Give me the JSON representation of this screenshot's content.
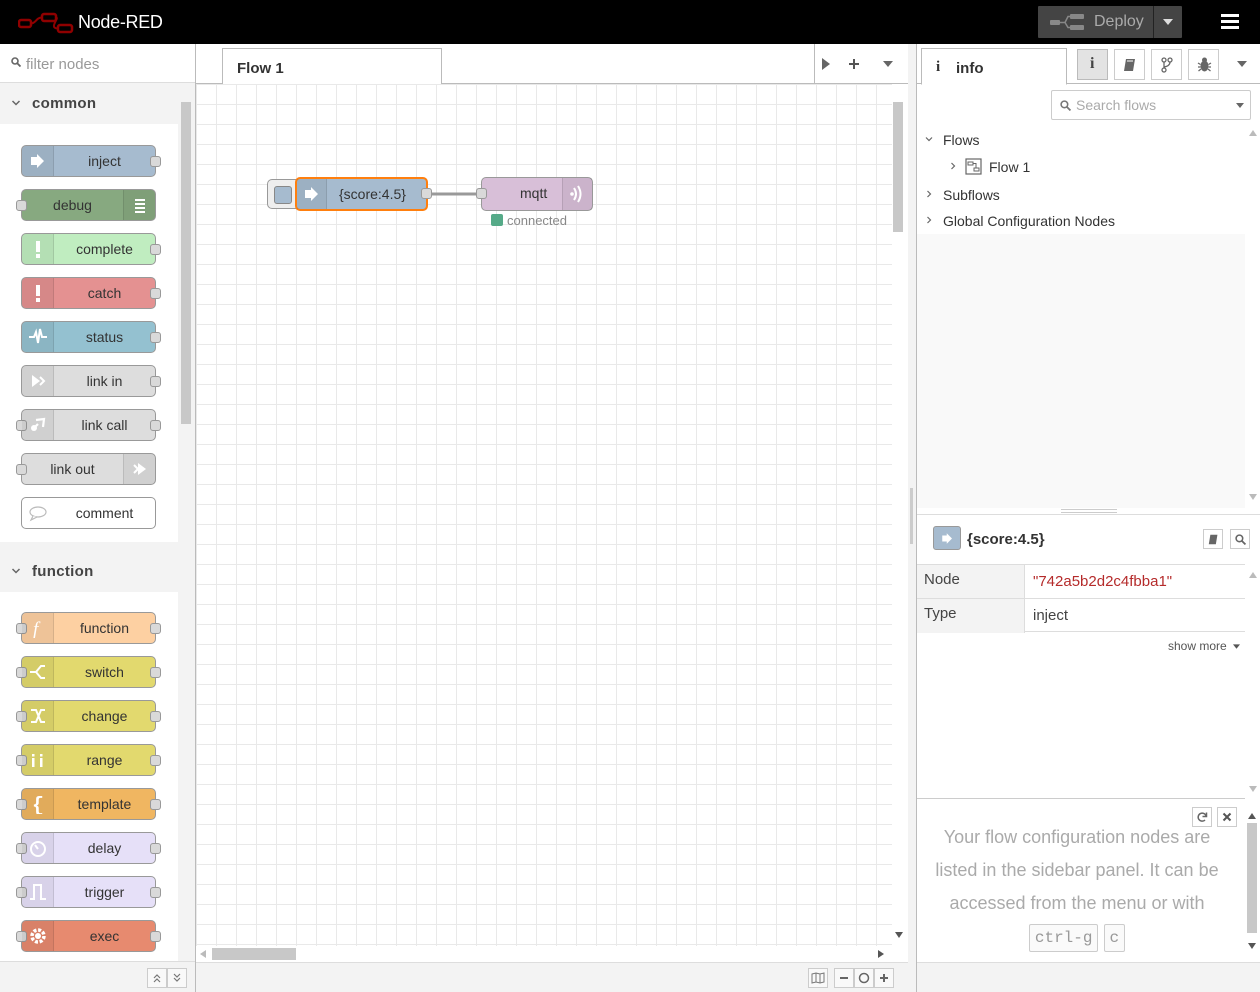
{
  "header": {
    "title": "Node-RED",
    "deploy_label": "Deploy"
  },
  "palette": {
    "filter_placeholder": "filter nodes",
    "categories": [
      {
        "label": "common",
        "nodes": [
          {
            "label": "inject",
            "color": "#a6bbcf",
            "icon": "inject-icon"
          },
          {
            "label": "debug",
            "color": "#87a980",
            "icon": "debug-icon"
          },
          {
            "label": "complete",
            "color": "#c0edc0",
            "icon": "alert-icon"
          },
          {
            "label": "catch",
            "color": "#e49191",
            "icon": "alert-icon"
          },
          {
            "label": "status",
            "color": "#94c1d0",
            "icon": "status-icon"
          },
          {
            "label": "link in",
            "color": "#dddddd",
            "icon": "link-in-icon"
          },
          {
            "label": "link call",
            "color": "#dddddd",
            "icon": "link-call-icon"
          },
          {
            "label": "link out",
            "color": "#dddddd",
            "icon": "link-out-icon"
          },
          {
            "label": "comment",
            "color": "#ffffff",
            "icon": "comment-icon"
          }
        ]
      },
      {
        "label": "function",
        "nodes": [
          {
            "label": "function",
            "color": "#fdd0a2",
            "icon": "function-icon"
          },
          {
            "label": "switch",
            "color": "#e2d96e",
            "icon": "switch-icon"
          },
          {
            "label": "change",
            "color": "#e2d96e",
            "icon": "change-icon"
          },
          {
            "label": "range",
            "color": "#e2d96e",
            "icon": "range-icon"
          },
          {
            "label": "template",
            "color": "#f0b661",
            "icon": "template-icon"
          },
          {
            "label": "delay",
            "color": "#e6e0f8",
            "icon": "timer-icon"
          },
          {
            "label": "trigger",
            "color": "#e6e0f8",
            "icon": "trigger-icon"
          },
          {
            "label": "exec",
            "color": "#e78a6f",
            "icon": "cog-icon"
          }
        ]
      }
    ]
  },
  "workspace": {
    "tabs": [
      {
        "label": "Flow 1"
      }
    ],
    "nodes": [
      {
        "label": "{score:4.5}",
        "type": "inject",
        "color": "#a6bbcf",
        "selected": true
      },
      {
        "label": "mqtt",
        "type": "mqtt out",
        "color": "#d8bfd8",
        "status": "connected",
        "status_color": "#5a8"
      }
    ]
  },
  "sidebar": {
    "tab_label": "info",
    "search_placeholder": "Search flows",
    "tree": {
      "flows_label": "Flows",
      "flow1_label": "Flow 1",
      "subflows_label": "Subflows",
      "global_config_label": "Global Configuration Nodes"
    },
    "info": {
      "title": "{score:4.5}",
      "rows": [
        {
          "key": "Node",
          "value": "\"742a5b2d2c4fbba1\""
        },
        {
          "key": "Type",
          "value": "inject"
        }
      ],
      "show_more": "show more"
    },
    "tip": {
      "text": "Your flow configuration nodes are listed in the sidebar panel. It can be accessed from the menu or with",
      "key1": "ctrl-g",
      "key2": "c"
    }
  }
}
